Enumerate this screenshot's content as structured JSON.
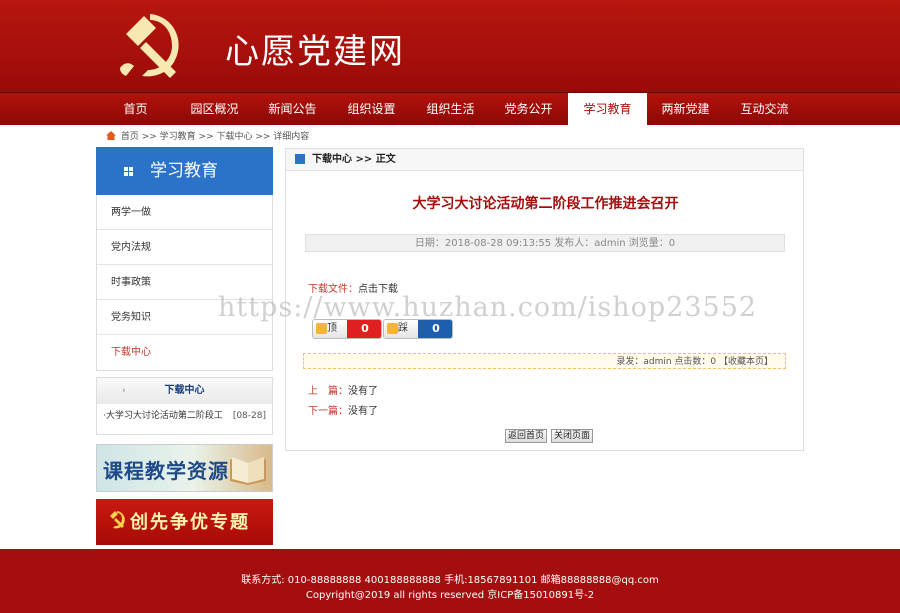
{
  "site": {
    "title": "心愿党建网"
  },
  "nav": {
    "items": [
      "首页",
      "园区概况",
      "新闻公告",
      "组织设置",
      "组织生活",
      "党务公开",
      "学习教育",
      "两新党建",
      "互动交流"
    ],
    "active_index": 6
  },
  "breadcrumb": {
    "text": "首页 >> 学习教育 >> 下载中心 >> 详细内容"
  },
  "sidebar": {
    "title": "学习教育",
    "items": [
      "两学一做",
      "党内法规",
      "时事政策",
      "党务知识",
      "下载中心"
    ],
    "active_index": 4
  },
  "download_box": {
    "title": "下载中心",
    "items": [
      {
        "label": "·大学习大讨论活动第二阶段工",
        "date": "[08-28]"
      }
    ]
  },
  "banners": {
    "course": "课程教学资源",
    "special": "创先争优专题"
  },
  "content": {
    "header": "下载中心 >> 正文",
    "article_title": "大学习大讨论活动第二阶段工作推进会召开",
    "meta": "日期：2018-08-28 09:13:55  发布人：admin  浏览量：0",
    "file_label": "下载文件：",
    "file_link": "点击下载",
    "vote_up_label": "顶",
    "vote_up_count": "0",
    "vote_down_label": "踩",
    "vote_down_count": "0",
    "info_bar": "录发：admin    点击数：0   【收藏本页】",
    "prev_label": "上　篇：",
    "prev_value": "没有了",
    "next_label": "下一篇：",
    "next_value": "没有了",
    "back_button": "返回首页",
    "close_button": "关闭页面"
  },
  "watermark": "https://www.huzhan.com/ishop23552",
  "footer": {
    "line1": "联系方式: 010-88888888 400188888888 手机:18567891101 邮箱88888888@qq.com",
    "line2": "Copyright@2019 all rights reserved 京ICP备15010891号-2"
  },
  "colors": {
    "brand_red": "#a50e0e",
    "sidebar_blue": "#2a73c9",
    "vote_up": "#e02020",
    "vote_down": "#1d5fae"
  }
}
